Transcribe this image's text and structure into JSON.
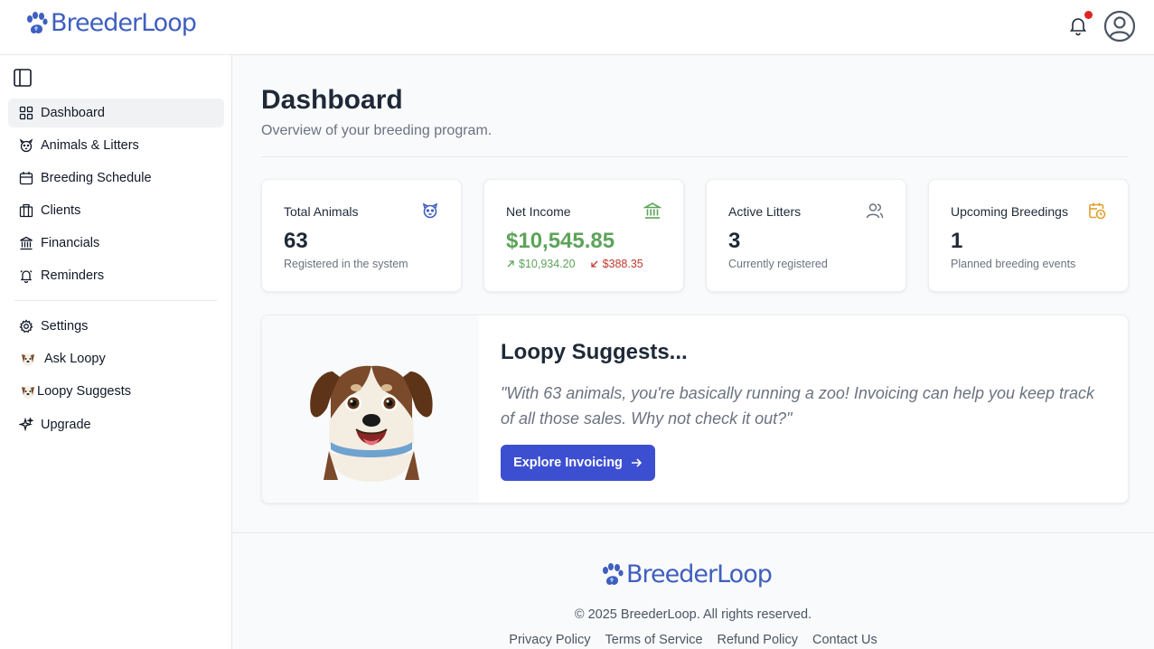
{
  "brand": {
    "name": "BreederLoop",
    "color": "#3f5fbf"
  },
  "header": {
    "notification_dot": true
  },
  "sidebar": {
    "items": [
      {
        "label": "Dashboard",
        "icon": "grid-icon",
        "active": true
      },
      {
        "label": "Animals & Litters",
        "icon": "dog-face-icon"
      },
      {
        "label": "Breeding Schedule",
        "icon": "calendar-icon"
      },
      {
        "label": "Clients",
        "icon": "building-icon"
      },
      {
        "label": "Financials",
        "icon": "bank-icon"
      },
      {
        "label": "Reminders",
        "icon": "bell-icon"
      }
    ],
    "secondary": [
      {
        "label": "Settings",
        "icon": "gear-icon"
      },
      {
        "label": "Ask Loopy",
        "icon": "dog-emoji-icon"
      },
      {
        "label": "Loopy Suggests",
        "icon": "dog-emoji-icon"
      },
      {
        "label": "Upgrade",
        "icon": "sparkles-icon"
      }
    ]
  },
  "page": {
    "title": "Dashboard",
    "subtitle": "Overview of your breeding program."
  },
  "stats": [
    {
      "title": "Total Animals",
      "value": "63",
      "sub": "Registered in the system",
      "icon": "dog-face-icon",
      "icon_color": "#3f5fbf"
    },
    {
      "title": "Net Income",
      "value": "$10,545.85",
      "income": "$10,934.20",
      "expenses": "$388.35",
      "icon": "bank-icon",
      "icon_color": "#5ea35a"
    },
    {
      "title": "Active Litters",
      "value": "3",
      "sub": "Currently registered",
      "icon": "users-icon",
      "icon_color": "#6b7280"
    },
    {
      "title": "Upcoming Breedings",
      "value": "1",
      "sub": "Planned breeding events",
      "icon": "calendar-clock-icon",
      "icon_color": "#e0a02a"
    }
  ],
  "suggest": {
    "title": "Loopy Suggests...",
    "quote": "\"With 63 animals, you're basically running a zoo! Invoicing can help you keep track of all those sales. Why not check it out?\"",
    "button_label": "Explore Invoicing",
    "button_color": "#3d4fd1"
  },
  "footer": {
    "copyright": "© 2025 BreederLoop. All rights reserved.",
    "links": [
      "Privacy Policy",
      "Terms of Service",
      "Refund Policy",
      "Contact Us"
    ]
  }
}
